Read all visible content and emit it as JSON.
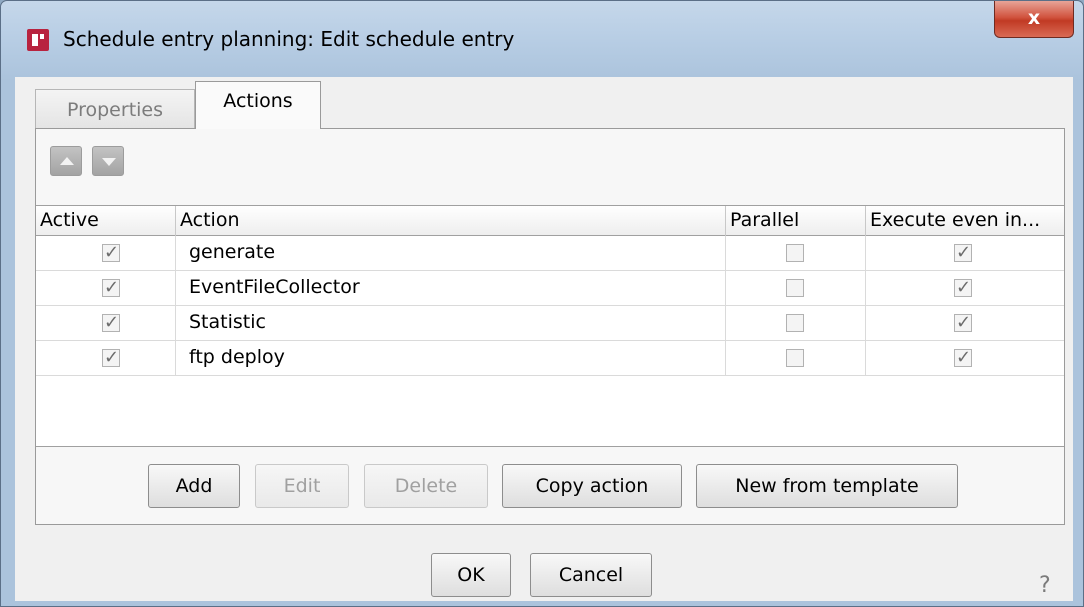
{
  "window": {
    "title": "Schedule entry planning:  Edit schedule entry",
    "close_label": "x"
  },
  "tabs": [
    {
      "label": "Properties",
      "selected": false
    },
    {
      "label": "Actions",
      "selected": true
    }
  ],
  "table": {
    "columns": [
      "Active",
      "Action",
      "Parallel",
      "Execute even in..."
    ],
    "rows": [
      {
        "active": true,
        "action": "generate",
        "parallel": false,
        "execute": true
      },
      {
        "active": true,
        "action": "EventFileCollector",
        "parallel": false,
        "execute": true
      },
      {
        "active": true,
        "action": "Statistic",
        "parallel": false,
        "execute": true
      },
      {
        "active": true,
        "action": "ftp deploy",
        "parallel": false,
        "execute": true
      }
    ]
  },
  "table_buttons": {
    "add": "Add",
    "edit": "Edit",
    "delete": "Delete",
    "copy": "Copy action",
    "new_from_template": "New from template"
  },
  "dialog_buttons": {
    "ok": "OK",
    "cancel": "Cancel",
    "help": "?"
  },
  "icons": {
    "app": "firstspirit-app-icon",
    "move_up": "arrow-up-icon",
    "move_down": "arrow-down-icon"
  }
}
